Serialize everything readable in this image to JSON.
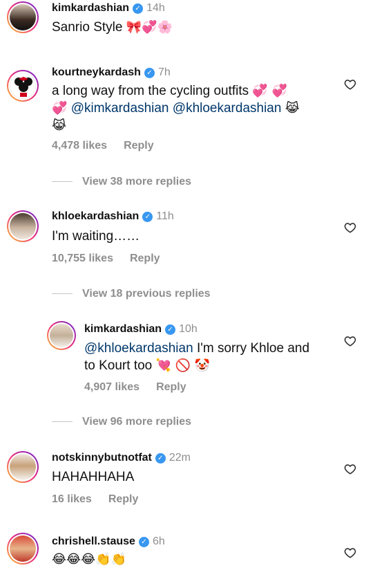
{
  "comments": [
    {
      "username": "kimkardashian",
      "time": "14h",
      "text": "Sanrio Style",
      "emoji": "🎀💞🌸"
    },
    {
      "username": "kourtneykardash",
      "time": "7h",
      "text_pre": "a long way from the cycling outfits",
      "emoji_a": "💞 💞",
      "emoji_b": "💞",
      "mention1": "@kimkardashian",
      "mention2": "@khloekardashian",
      "emoji_c": "😹",
      "emoji_d": "😹",
      "likes": "4,478 likes",
      "reply": "Reply",
      "view_more": "View 38 more replies"
    },
    {
      "username": "khloekardashian",
      "time": "11h",
      "text": "I'm waiting……",
      "likes": "10,755 likes",
      "reply": "Reply",
      "view_more": "View 18 previous replies"
    },
    {
      "username": "kimkardashian",
      "time": "10h",
      "mention": "@khloekardashian",
      "text_a": " I'm sorry Khloe and",
      "text_b": "to Kourt too",
      "emoji": "💘 🚫 🤡",
      "likes": "4,907 likes",
      "reply": "Reply",
      "view_more": "View 96 more replies"
    },
    {
      "username": "notskinnybutnotfat",
      "time": "22m",
      "text": "HAHAHHAHA",
      "likes": "16 likes",
      "reply": "Reply"
    },
    {
      "username": "chrishell.stause",
      "time": "6h",
      "emoji": "😂😂😂👏👏"
    }
  ]
}
